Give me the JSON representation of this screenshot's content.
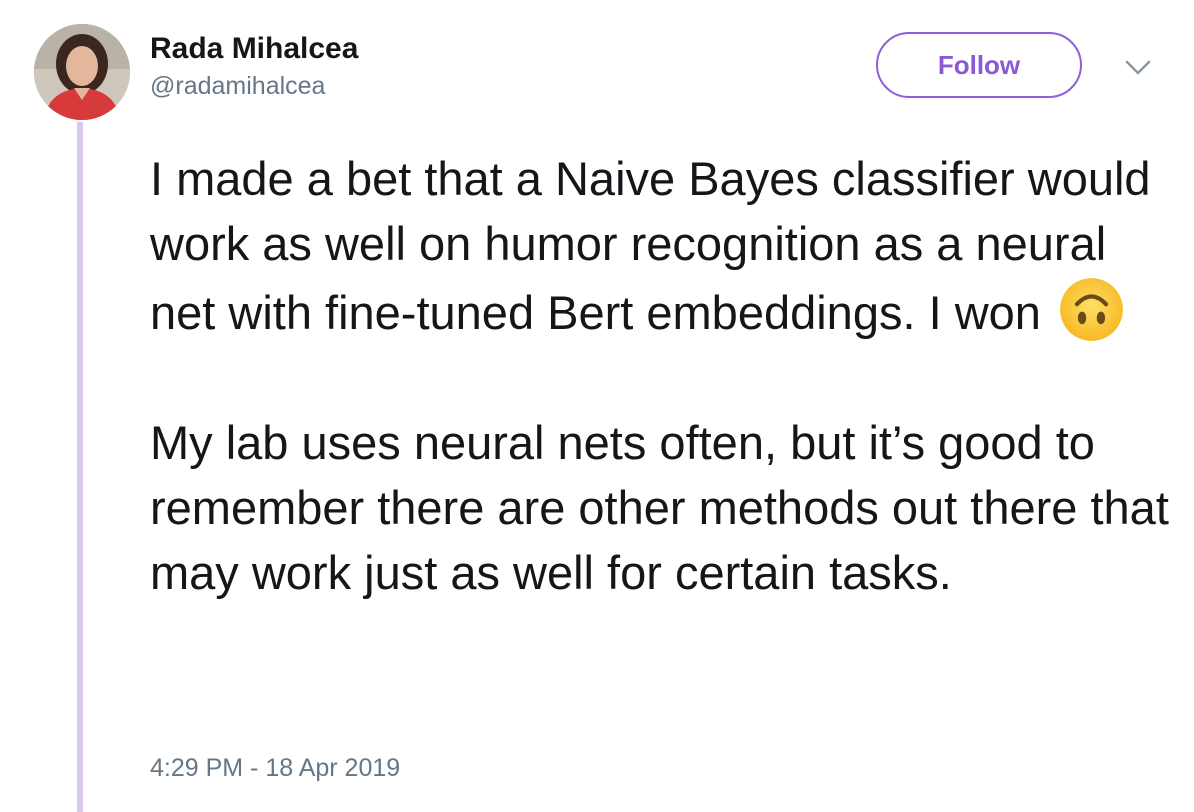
{
  "author": {
    "name": "Rada Mihalcea",
    "handle": "@radamihalcea"
  },
  "actions": {
    "follow_label": "Follow"
  },
  "tweet": {
    "paragraph1": "I made a bet that a Naive Bayes classifier would work as well on humor recognition as a neural net with fine-tuned Bert embeddings. I won",
    "emoji": "upside-down-face",
    "paragraph2": "My lab uses neural nets often, but it’s good to remember there are other methods out there that may work just as well for certain tasks."
  },
  "timestamp": "4:29 PM - 18 Apr 2019",
  "colors": {
    "accent": "#8c59d4",
    "thread_line": "#d8c8ee",
    "secondary_text": "#657786"
  }
}
